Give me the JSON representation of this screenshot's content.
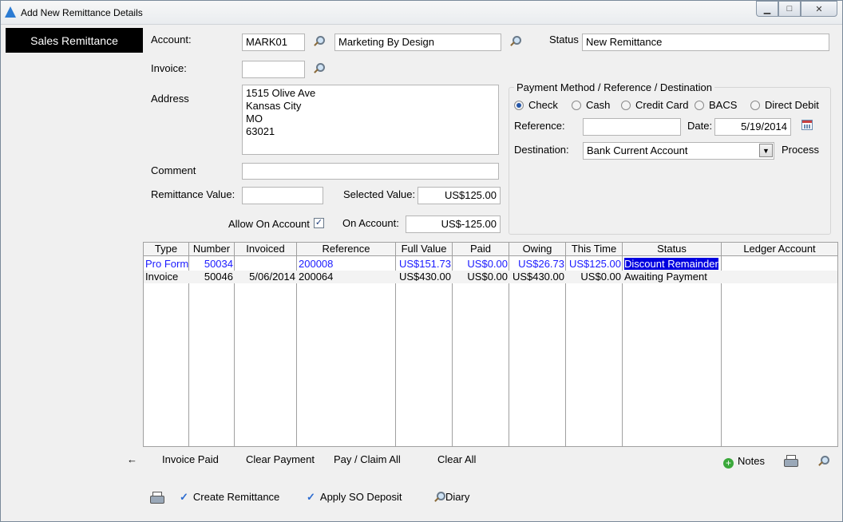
{
  "window": {
    "title": "Add New Remittance Details",
    "controls": {
      "minimize": "▁",
      "maximize": "□",
      "close": "✕"
    }
  },
  "sidebar": {
    "items": [
      {
        "label": "Sales Remittance"
      }
    ]
  },
  "form": {
    "account_label": "Account:",
    "account_code": "MARK01",
    "account_name": "Marketing By Design",
    "status_label": "Status",
    "status_value": "New Remittance",
    "invoice_label": "Invoice:",
    "invoice_value": "",
    "address_label": "Address",
    "address_lines": [
      "1515 Olive Ave",
      "Kansas City",
      "MO",
      "63021"
    ],
    "comment_label": "Comment",
    "comment_value": "",
    "remittance_value_label": "Remittance Value:",
    "remittance_value": "",
    "selected_value_label": "Selected Value:",
    "selected_value": "US$125.00",
    "allow_on_account_label": "Allow On Account",
    "allow_on_account_checked": "✓",
    "on_account_label": "On Account:",
    "on_account_value": "US$-125.00"
  },
  "payment": {
    "group_title": "Payment Method / Reference / Destination",
    "methods": [
      "Check",
      "Cash",
      "Credit Card",
      "BACS",
      "Direct Debit"
    ],
    "selected_method": "Check",
    "reference_label": "Reference:",
    "reference_value": "",
    "date_label": "Date:",
    "date_value": "5/19/2014",
    "destination_label": "Destination:",
    "destination_value": "Bank Current Account",
    "process_label": "Process"
  },
  "grid": {
    "columns": [
      "Type",
      "Number",
      "Invoiced",
      "Reference",
      "Full Value",
      "Paid",
      "Owing",
      "This Time",
      "Status",
      "Ledger Account"
    ],
    "rows": [
      {
        "type": "Pro Form",
        "number": "50034",
        "invoiced": "",
        "reference": "200008",
        "full_value": "US$151.73",
        "paid": "US$0.00",
        "owing": "US$26.73",
        "this_time": "US$125.00",
        "status": "Discount Remainder",
        "ledger": ""
      },
      {
        "type": "Invoice",
        "number": "50046",
        "invoiced": "5/06/2014",
        "reference": "200064",
        "full_value": "US$430.00",
        "paid": "US$0.00",
        "owing": "US$430.00",
        "this_time": "US$0.00",
        "status": "Awaiting Payment",
        "ledger": ""
      }
    ]
  },
  "grid_actions": {
    "back": "←",
    "invoice_paid": "Invoice Paid",
    "clear_payment": "Clear Payment",
    "pay_claim_all": "Pay / Claim All",
    "clear_all": "Clear All",
    "notes": "Notes"
  },
  "bottom": {
    "create_remittance": "Create Remittance",
    "apply_so_deposit": "Apply SO Deposit",
    "diary": "Diary"
  },
  "colors": {
    "accent": "#0000e0",
    "row_link": "#1a1aff",
    "tab_bg": "#000000"
  }
}
